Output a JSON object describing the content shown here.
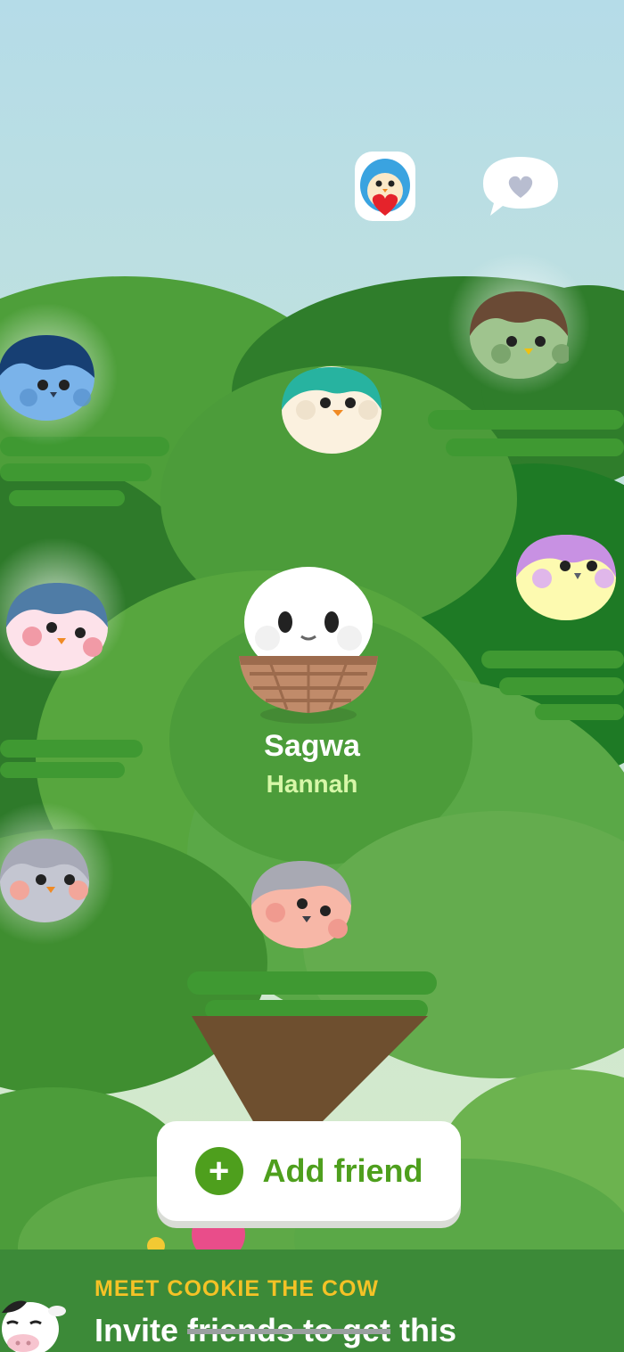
{
  "center_bird": {
    "name": "Sagwa",
    "owner": "Hannah"
  },
  "add_friend": {
    "label": "Add friend",
    "icon": "plus-icon"
  },
  "promo": {
    "kicker": "MEET COOKIE THE COW",
    "headline_start": "Invite ",
    "headline_struck": "friends to get",
    "headline_end": " this",
    "icon": "cow-icon"
  },
  "top_icons": [
    "bird-with-heart-icon",
    "heart-speech-bubble-icon"
  ],
  "colors": {
    "sky_top": "#b5dce8",
    "sky_bottom": "#d9ecc7",
    "accent_green": "#4e9f1d",
    "promo_bg": "#3c8a38",
    "promo_kicker": "#f4c226"
  }
}
